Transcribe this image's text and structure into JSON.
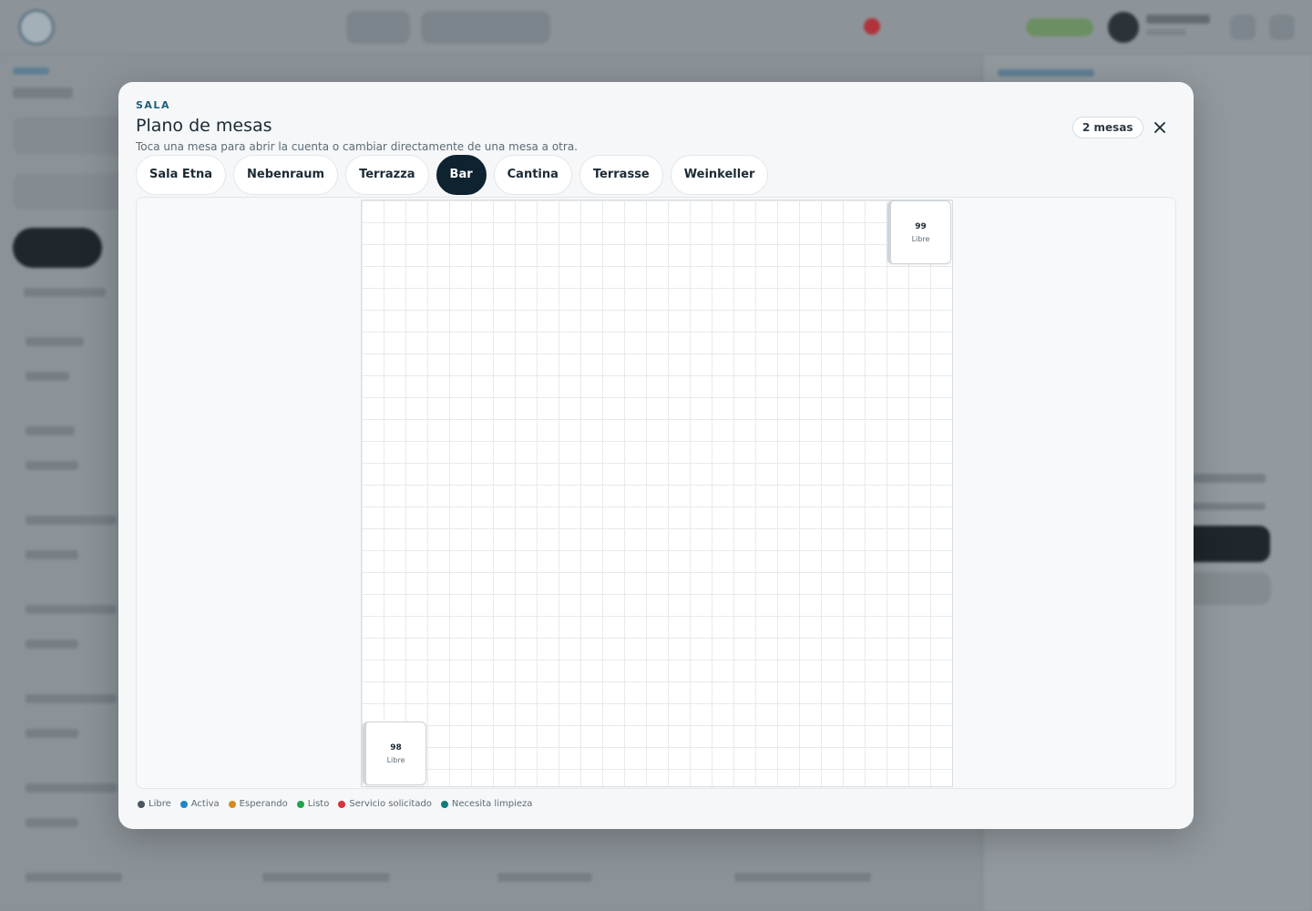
{
  "modal": {
    "eyebrow": "SALA",
    "title": "Plano de mesas",
    "subtitle": "Toca una mesa para abrir la cuenta o cambiar directamente de una mesa a otra.",
    "count": "2 mesas"
  },
  "tabs": [
    {
      "label": "Sala Etna",
      "active": false
    },
    {
      "label": "Nebenraum",
      "active": false
    },
    {
      "label": "Terrazza",
      "active": false
    },
    {
      "label": "Bar",
      "active": true
    },
    {
      "label": "Cantina",
      "active": false
    },
    {
      "label": "Terrasse",
      "active": false
    },
    {
      "label": "Weinkeller",
      "active": false
    }
  ],
  "tables": [
    {
      "number": "99",
      "status": "Libre"
    },
    {
      "number": "98",
      "status": "Libre"
    }
  ],
  "legend": [
    {
      "label": "Libre",
      "color": "#4a5660"
    },
    {
      "label": "Activa",
      "color": "#1f86c4"
    },
    {
      "label": "Esperando",
      "color": "#d68a1a"
    },
    {
      "label": "Listo",
      "color": "#22a34a"
    },
    {
      "label": "Servicio solicitado",
      "color": "#d8323c"
    },
    {
      "label": "Necesita limpieza",
      "color": "#137a7a"
    }
  ]
}
